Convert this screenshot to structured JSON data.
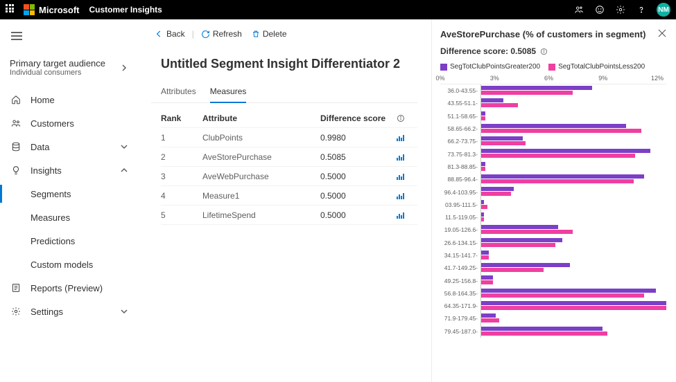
{
  "header": {
    "brand": "Microsoft",
    "product": "Customer Insights",
    "avatar": "NM"
  },
  "audience": {
    "title": "Primary target audience",
    "subtitle": "Individual consumers"
  },
  "nav": {
    "home": "Home",
    "customers": "Customers",
    "data": "Data",
    "insights": "Insights",
    "segments": "Segments",
    "measures": "Measures",
    "predictions": "Predictions",
    "custom_models": "Custom models",
    "reports": "Reports (Preview)",
    "settings": "Settings"
  },
  "cmd": {
    "back": "Back",
    "refresh": "Refresh",
    "delete": "Delete"
  },
  "page_title": "Untitled Segment Insight Differentiator 2",
  "tabs": {
    "attributes": "Attributes",
    "measures": "Measures"
  },
  "table": {
    "cols": {
      "rank": "Rank",
      "attribute": "Attribute",
      "diff": "Difference score"
    },
    "rows": [
      {
        "rank": "1",
        "attr": "ClubPoints",
        "score": "0.9980"
      },
      {
        "rank": "2",
        "attr": "AveStorePurchase",
        "score": "0.5085"
      },
      {
        "rank": "3",
        "attr": "AveWebPurchase",
        "score": "0.5000"
      },
      {
        "rank": "4",
        "attr": "Measure1",
        "score": "0.5000"
      },
      {
        "rank": "5",
        "attr": "LifetimeSpend",
        "score": "0.5000"
      }
    ]
  },
  "panel": {
    "title": "AveStorePurchase (% of customers in segment)",
    "diff_label": "Difference score: 0.5085",
    "legend": {
      "a": "SegTotClubPointsGreater200",
      "b": "SegTotalClubPointsLess200"
    }
  },
  "chart_data": {
    "type": "bar",
    "xlabel": "",
    "ylabel": "",
    "xlim": [
      0,
      12.5
    ],
    "x_ticks": [
      "0%",
      "3%",
      "6%",
      "9%",
      "12%"
    ],
    "series_names": [
      "SegTotClubPointsGreater200",
      "SegTotalClubPointsLess200"
    ],
    "categories": [
      "36.0-43.55",
      "43.55-51.1",
      "51.1-58.65",
      "58.65-66.2",
      "66.2-73.75",
      "73.75-81.3",
      "81.3-88.85",
      "88.85-96.4",
      "96.4-103.95",
      "03.95-111.5",
      "11.5-119.05",
      "19.05-126.6",
      "26.6-134.15",
      "34.15-141.7",
      "41.7-149.25",
      "49.25-156.8",
      "56.8-164.35",
      "64.35-171.9",
      "71.9-179.45",
      "79.45-187.0"
    ],
    "series": [
      {
        "name": "SegTotClubPointsGreater200",
        "color": "#7c3fc7",
        "values": [
          7.5,
          1.5,
          0.3,
          9.8,
          2.8,
          11.4,
          0.3,
          11.0,
          2.2,
          0.2,
          0.2,
          5.2,
          5.5,
          0.5,
          6.0,
          0.8,
          11.8,
          12.5,
          1.0,
          8.2
        ]
      },
      {
        "name": "SegTotalClubPointsLess200",
        "color": "#ef3fa1",
        "values": [
          6.2,
          2.5,
          0.3,
          10.8,
          3.0,
          10.4,
          0.3,
          10.3,
          2.0,
          0.4,
          0.2,
          6.2,
          5.0,
          0.5,
          4.2,
          0.8,
          11.0,
          12.5,
          1.2,
          8.5
        ]
      }
    ]
  }
}
